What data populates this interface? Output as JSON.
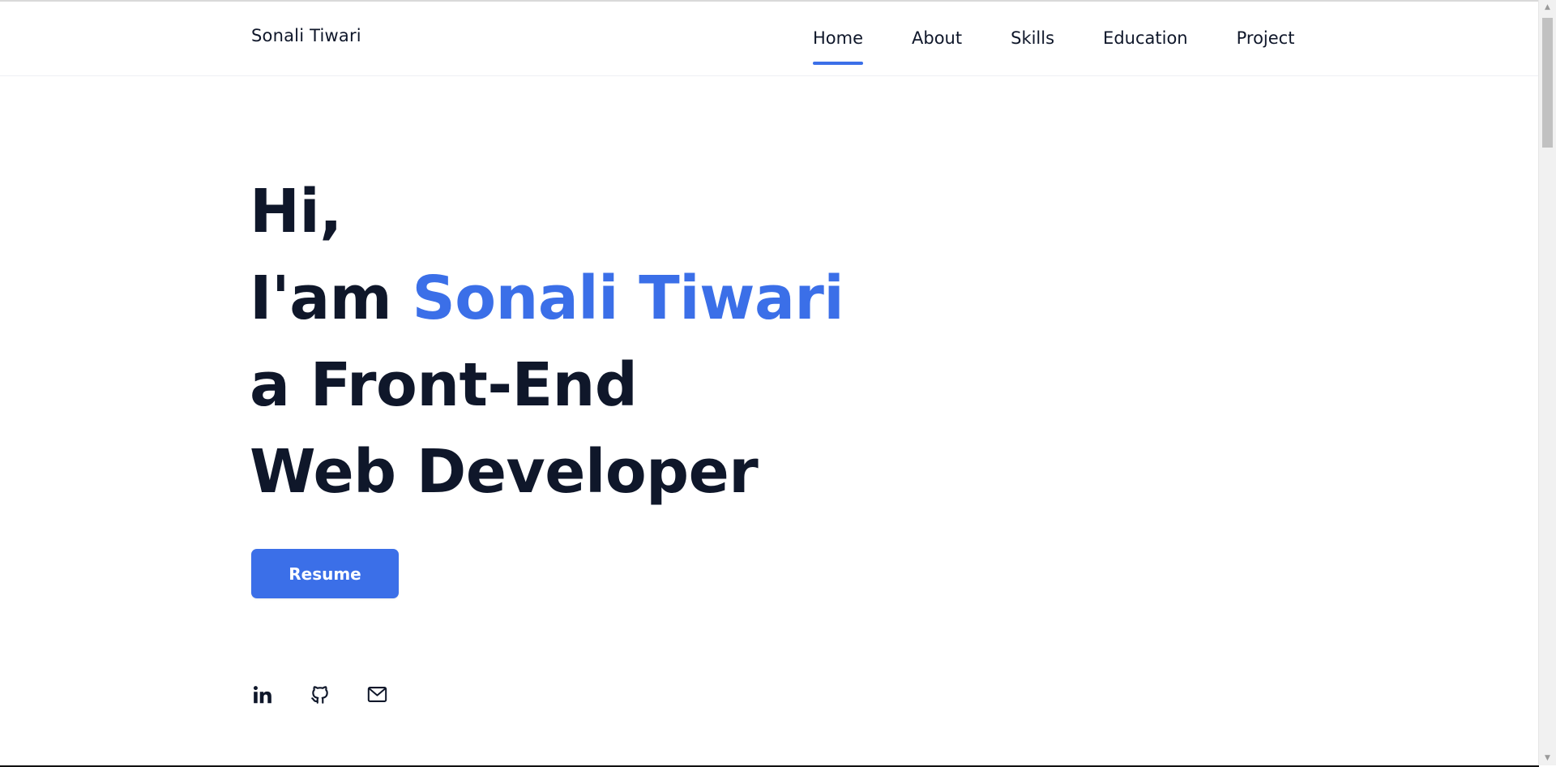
{
  "header": {
    "brand": "Sonali Tiwari",
    "nav": [
      {
        "label": "Home",
        "active": true
      },
      {
        "label": "About",
        "active": false
      },
      {
        "label": "Skills",
        "active": false
      },
      {
        "label": "Education",
        "active": false
      },
      {
        "label": "Project",
        "active": false
      }
    ]
  },
  "hero": {
    "greeting": "Hi,",
    "intro_prefix": "I'am ",
    "name": "Sonali Tiwari",
    "line3": "a Front-End",
    "line4": "Web Developer"
  },
  "resume_button": "Resume",
  "socials": [
    {
      "icon": "linkedin-icon"
    },
    {
      "icon": "github-icon"
    },
    {
      "icon": "mail-icon"
    }
  ],
  "colors": {
    "accent": "#3b6fe8",
    "text": "#0f172a",
    "background": "#ffffff"
  }
}
